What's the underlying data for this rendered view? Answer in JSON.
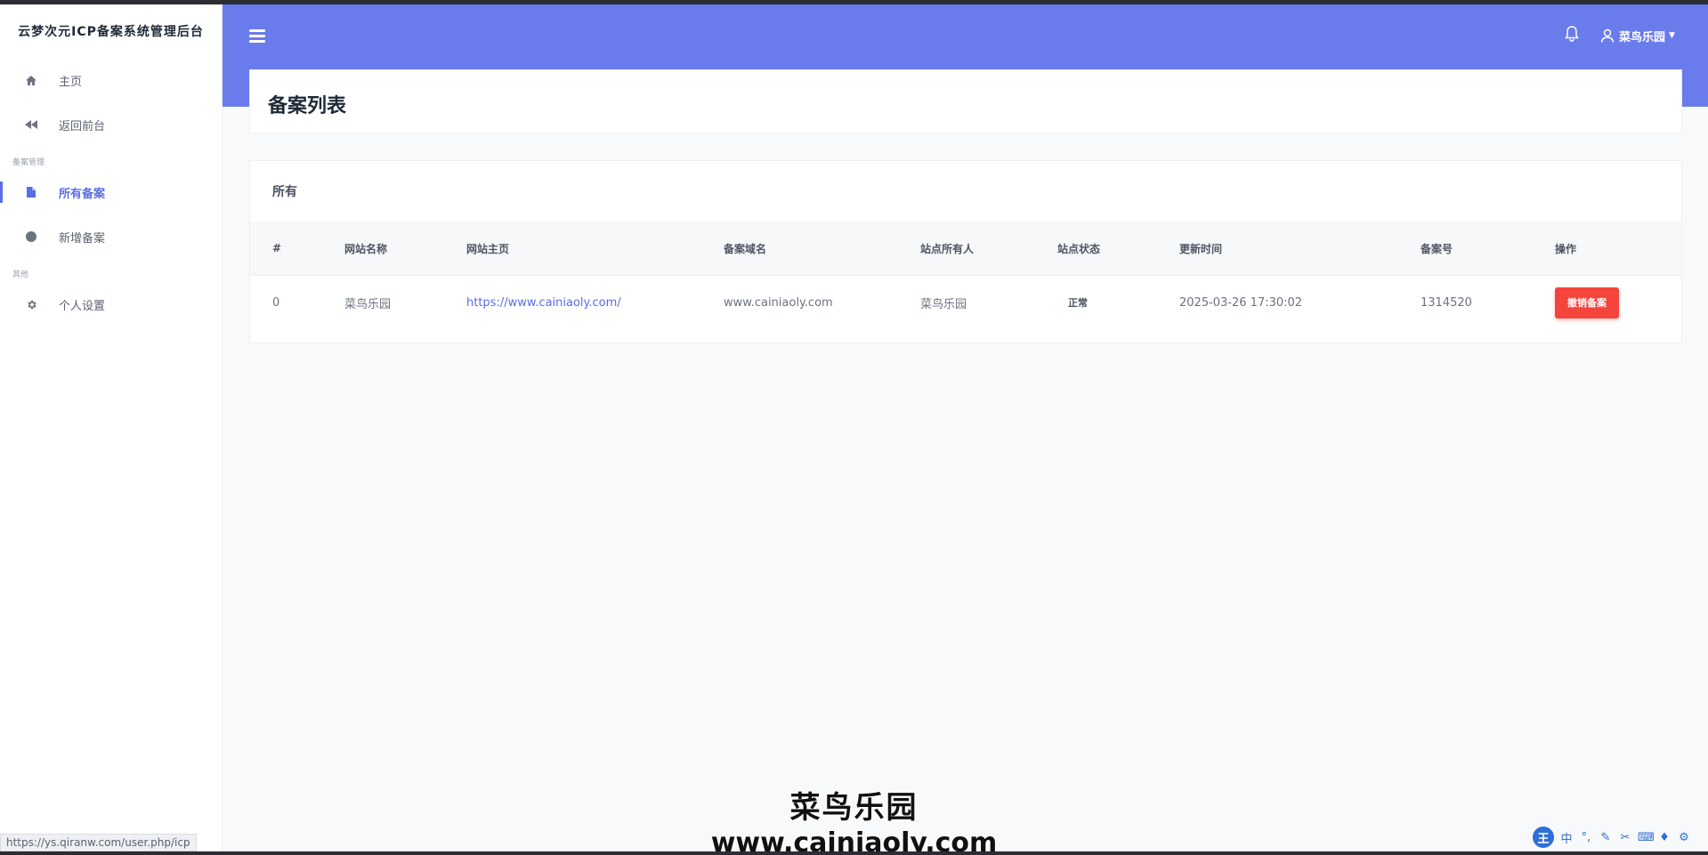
{
  "sidebar": {
    "brand": "云梦次元ICP备案系统管理后台",
    "items": [
      {
        "label": "主页",
        "icon": "home-icon"
      },
      {
        "label": "返回前台",
        "icon": "backward-icon"
      }
    ],
    "section1": "备案管理",
    "items2": [
      {
        "label": "所有备案",
        "icon": "file-icon",
        "active": true
      },
      {
        "label": "新增备案",
        "icon": "circle-icon"
      }
    ],
    "section2": "其他",
    "items3": [
      {
        "label": "个人设置",
        "icon": "gear-icon"
      }
    ]
  },
  "header": {
    "username": "菜鸟乐园",
    "accent": "#6a7cec"
  },
  "page": {
    "title": "备案列表",
    "section": "所有"
  },
  "table": {
    "columns": [
      "#",
      "网站名称",
      "网站主页",
      "备案域名",
      "站点所有人",
      "站点状态",
      "更新时间",
      "备案号",
      "操作"
    ],
    "rows": [
      {
        "index": "0",
        "site_name": "菜鸟乐园",
        "homepage": "https://www.cainiaoly.com/",
        "domain": "www.cainiaoly.com",
        "owner": "菜鸟乐园",
        "status": "正常",
        "updated": "2025-03-26 17:30:02",
        "icp_no": "1314520",
        "action": "撤销备案"
      }
    ]
  },
  "watermark": {
    "line1": "菜鸟乐园",
    "line2": "www.cainiaoly.com"
  },
  "statusbar": {
    "url": "https://ys.qiranw.com/user.php/icp"
  },
  "ime": {
    "logo": "王",
    "mode": "中"
  }
}
